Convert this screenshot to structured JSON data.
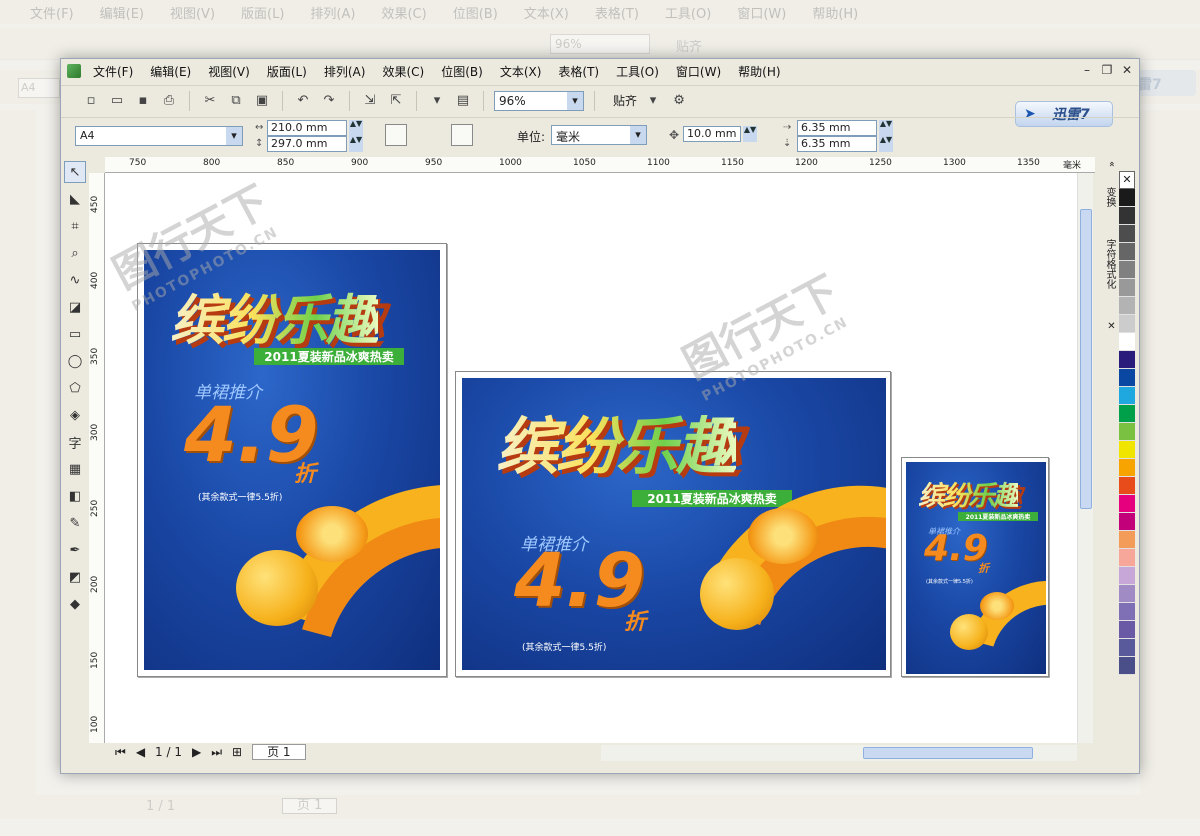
{
  "menus": [
    "文件(F)",
    "编辑(E)",
    "视图(V)",
    "版面(L)",
    "排列(A)",
    "效果(C)",
    "位图(B)",
    "文本(X)",
    "表格(T)",
    "工具(O)",
    "窗口(W)",
    "帮助(H)"
  ],
  "toolbar": {
    "zoom": "96%",
    "snap_label": "贴齐"
  },
  "brand_logo": "迅雷7",
  "properties": {
    "page_size": "A4",
    "width": "210.0 mm",
    "height": "297.0 mm",
    "unit_label": "单位:",
    "unit": "毫米",
    "nudge": "10.0 mm",
    "dup_x": "6.35 mm",
    "dup_y": "6.35 mm"
  },
  "ruler": {
    "top_ticks": [
      "750",
      "800",
      "850",
      "900",
      "950",
      "1000",
      "1050",
      "1100",
      "1150",
      "1200",
      "1250",
      "1300",
      "1350"
    ],
    "unit": "毫米",
    "left_ticks": [
      "450",
      "400",
      "350",
      "300",
      "250",
      "200",
      "150",
      "100"
    ]
  },
  "status": {
    "page_count": "1 / 1",
    "page_tab": "页 1"
  },
  "dockers": [
    "变换",
    "字符格式化"
  ],
  "posters": {
    "title": "缤纷乐趣",
    "tag": "2011夏装新品冰爽热卖",
    "subtitle": "单裙推介",
    "price": "4.9",
    "discount": "折",
    "note": "(其余款式一律5.5折)"
  },
  "watermark": {
    "text": "图行天下",
    "url": "PHOTOPHOTO.CN"
  },
  "background_app": {
    "menus": [
      "文件(F)",
      "编辑(E)",
      "视图(V)",
      "版面(L)",
      "排列(A)",
      "效果(C)",
      "位图(B)",
      "文本(X)",
      "表格(T)",
      "工具(O)",
      "窗口(W)",
      "帮助(H)"
    ],
    "zoom": "96%",
    "snap_label": "贴齐",
    "page_size": "A4",
    "page_count": "1 / 1",
    "page_tab": "页 1"
  },
  "palette_colors": [
    "#1a1a1a",
    "#333333",
    "#4d4d4d",
    "#666666",
    "#808080",
    "#999999",
    "#b3b3b3",
    "#cccccc",
    "#ffffff",
    "#2a1c7a",
    "#0a47a3",
    "#1fa8e0",
    "#00a04a",
    "#7ac142",
    "#f0e500",
    "#f7a300",
    "#e84c1a",
    "#e6007e",
    "#c2007a",
    "#f39c5a",
    "#f6a799",
    "#c7a7d8",
    "#a08bc5",
    "#7f70b6",
    "#6a5aa6",
    "#585a9b",
    "#4a4f8a"
  ]
}
